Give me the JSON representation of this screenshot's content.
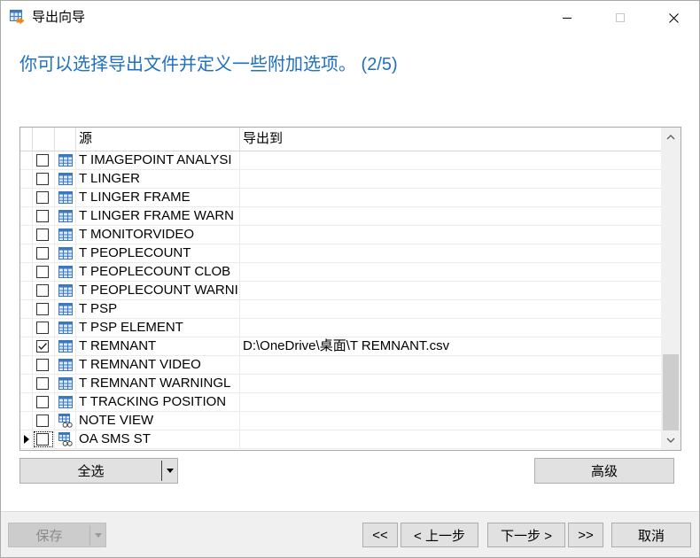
{
  "window": {
    "title": "导出向导"
  },
  "header": {
    "text": "你可以选择导出文件并定义一些附加选项。 (2/5)"
  },
  "grid": {
    "columns": [
      "源",
      "导出到"
    ],
    "rows": [
      {
        "name": "T IMAGEPOINT ANALYSI",
        "icon": "table-icon",
        "checked": false,
        "export_to": ""
      },
      {
        "name": "T LINGER",
        "icon": "table-icon",
        "checked": false,
        "export_to": ""
      },
      {
        "name": "T LINGER FRAME",
        "icon": "table-icon",
        "checked": false,
        "export_to": ""
      },
      {
        "name": "T LINGER FRAME WARN",
        "icon": "table-icon",
        "checked": false,
        "export_to": ""
      },
      {
        "name": "T MONITORVIDEO",
        "icon": "table-icon",
        "checked": false,
        "export_to": ""
      },
      {
        "name": "T PEOPLECOUNT",
        "icon": "table-icon",
        "checked": false,
        "export_to": ""
      },
      {
        "name": "T PEOPLECOUNT CLOB",
        "icon": "table-icon",
        "checked": false,
        "export_to": ""
      },
      {
        "name": "T PEOPLECOUNT WARNI",
        "icon": "table-icon",
        "checked": false,
        "export_to": ""
      },
      {
        "name": "T PSP",
        "icon": "table-icon",
        "checked": false,
        "export_to": ""
      },
      {
        "name": "T PSP ELEMENT",
        "icon": "table-icon",
        "checked": false,
        "export_to": ""
      },
      {
        "name": "T REMNANT",
        "icon": "table-icon",
        "checked": true,
        "export_to": "D:\\OneDrive\\桌面\\T REMNANT.csv"
      },
      {
        "name": "T REMNANT VIDEO",
        "icon": "table-icon",
        "checked": false,
        "export_to": ""
      },
      {
        "name": "T REMNANT WARNINGL",
        "icon": "table-icon",
        "checked": false,
        "export_to": ""
      },
      {
        "name": "T TRACKING POSITION",
        "icon": "table-icon",
        "checked": false,
        "export_to": ""
      },
      {
        "name": "NOTE VIEW",
        "icon": "view-icon",
        "checked": false,
        "export_to": ""
      },
      {
        "name": "OA SMS ST",
        "icon": "view-icon",
        "checked": false,
        "export_to": "",
        "current": true
      }
    ],
    "scroll": {
      "position": 1,
      "visible_fraction": 0.27
    }
  },
  "actions": {
    "select_all": {
      "label": "全选"
    },
    "advanced": {
      "label": "高级"
    }
  },
  "footer": {
    "save": {
      "label": "保存",
      "disabled": true
    },
    "first": {
      "label": "<<"
    },
    "prev": {
      "label": "< 上一步"
    },
    "next": {
      "label": "下一步 >"
    },
    "last": {
      "label": ">>"
    },
    "cancel": {
      "label": "取消"
    }
  },
  "colors": {
    "header_text": "#1f6fc5",
    "icon_blue": "#3a78c2",
    "icon_cell": "#dce9f8",
    "icon_arrow": "#e8891c"
  }
}
